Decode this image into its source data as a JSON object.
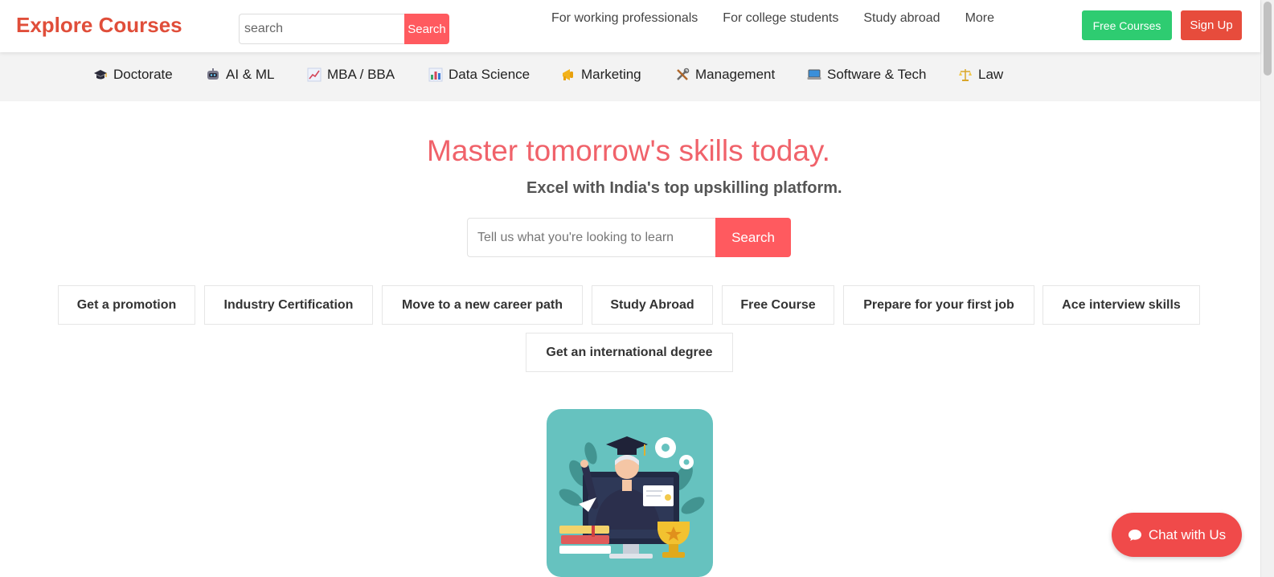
{
  "header": {
    "logo": "Explore Courses",
    "search_placeholder": "search",
    "search_button": "Search",
    "nav": [
      "For working professionals",
      "For college students",
      "Study abroad",
      "More"
    ],
    "free_courses": "Free Courses",
    "sign_up": "Sign Up"
  },
  "categories": [
    {
      "label": "Doctorate",
      "icon": "graduation-cap-icon"
    },
    {
      "label": "AI & ML",
      "icon": "robot-icon"
    },
    {
      "label": "MBA / BBA",
      "icon": "chart-increasing-icon"
    },
    {
      "label": "Data Science",
      "icon": "bar-chart-icon"
    },
    {
      "label": "Marketing",
      "icon": "megaphone-icon"
    },
    {
      "label": "Management",
      "icon": "tools-icon"
    },
    {
      "label": "Software & Tech",
      "icon": "laptop-icon"
    },
    {
      "label": "Law",
      "icon": "scales-icon"
    }
  ],
  "hero": {
    "title": "Master tomorrow's skills today.",
    "subtitle": "Excel with India's top upskilling platform.",
    "search_placeholder": "Tell us what you're looking to learn",
    "search_button": "Search"
  },
  "goals": [
    "Get a promotion",
    "Industry Certification",
    "Move to a new career path",
    "Study Abroad",
    "Free Course",
    "Prepare for your first job",
    "Ace interview skills",
    "Get an international degree"
  ],
  "chat": {
    "label": "Chat with Us"
  },
  "colors": {
    "brand": "#e04e3a",
    "accent": "#ff5a5f",
    "free": "#2ecc71",
    "signup": "#e74c3c",
    "illustration_bg": "#66c2bf"
  }
}
